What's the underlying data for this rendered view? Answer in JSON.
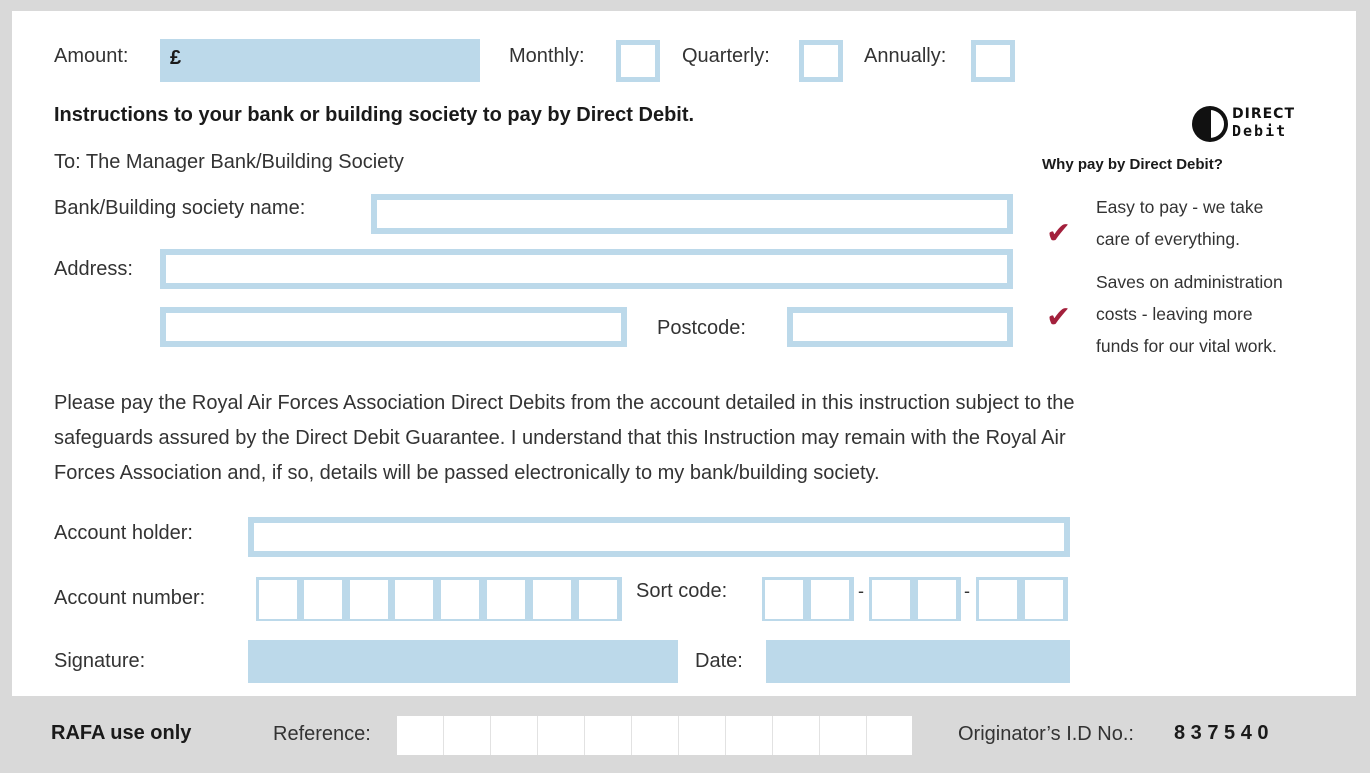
{
  "payment": {
    "amount_label": "Amount:",
    "currency_symbol": "£",
    "monthly_label": "Monthly:",
    "quarterly_label": "Quarterly:",
    "annually_label": "Annually:"
  },
  "heading": "Instructions to your bank or building society to pay by Direct Debit.",
  "logo": {
    "line1": "DIRECT",
    "line2": "Debit",
    "icon": "direct-debit-logo"
  },
  "to_line": "To: The Manager Bank/Building Society",
  "bank_name_label": "Bank/Building society name:",
  "address_label": "Address:",
  "postcode_label": "Postcode:",
  "why": {
    "title": "Why pay by Direct Debit?",
    "items": [
      {
        "line1": "Easy to pay - we take",
        "line2": "care of everything.",
        "line3": ""
      },
      {
        "line1": "Saves on administration",
        "line2": "costs - leaving more",
        "line3": "funds for our vital work."
      }
    ],
    "check_icon": "checkmark-icon",
    "check_color": "#a3203c"
  },
  "instruction_text": {
    "line1": "Please pay the Royal Air Forces Association Direct Debits from the account detailed in this instruction subject to the",
    "line2": "safeguards assured by the Direct Debit Guarantee. I understand that this Instruction may remain with the Royal Air",
    "line3": "Forces Association and, if so, details will be passed electronically to my bank/building society."
  },
  "account_holder_label": "Account holder:",
  "account_number_label": "Account number:",
  "sort_code_label": "Sort code:",
  "sort_separator": "-",
  "signature_label": "Signature:",
  "date_label": "Date:",
  "footer": {
    "rafa_label": "RAFA use only",
    "reference_label": "Reference:",
    "originator_label": "Originator’s I.D No.:",
    "originator_number": "8 3 7 5 4 0"
  },
  "colors": {
    "field_blue": "#bcd9ea",
    "background_grey": "#d9d9d9",
    "accent_red": "#a3203c"
  }
}
